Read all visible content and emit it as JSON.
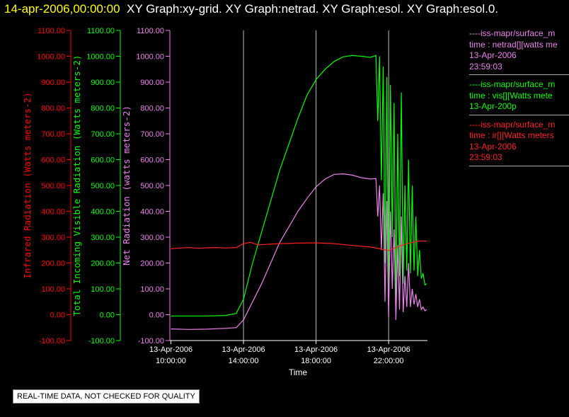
{
  "header": {
    "timestamp": "14-apr-2006,00:00:00",
    "graphs": "XY Graph:xy-grid.  XY Graph:netrad.  XY Graph:esol.  XY Graph:esol.0."
  },
  "status_note": "REAL-TIME DATA, NOT CHECKED FOR QUALITY",
  "legend": [
    {
      "color": "#ee82ee",
      "lines": [
        "----iss-mapr/surface_m",
        "time : netrad[][watts me",
        "13-Apr-2006",
        "23:59:03"
      ]
    },
    {
      "color": "#00ff00",
      "lines": [
        "----iss-mapr/surface_m",
        "time : vis[][Watts mete",
        "13-Apr-200p"
      ]
    },
    {
      "color": "#ff2020",
      "lines": [
        "----iss-mapr/surface_m",
        "time : ir[][Watts meters",
        "13-Apr-2006",
        "23:59:03"
      ]
    }
  ],
  "chart_data": {
    "type": "line",
    "xlabel": "Time",
    "x_ticks": [
      {
        "date": "13-Apr-2006",
        "time": "10:00:00",
        "hour": 10
      },
      {
        "date": "13-Apr-2006",
        "time": "14:00:00",
        "hour": 14
      },
      {
        "date": "13-Apr-2006",
        "time": "18:00:00",
        "hour": 18
      },
      {
        "date": "13-Apr-2006",
        "time": "22:00:00",
        "hour": 22
      }
    ],
    "xlim": [
      9.94,
      24.14
    ],
    "ylim": [
      -100,
      1100
    ],
    "y_ticks": [
      "-100.00",
      "0.00",
      "100.00",
      "200.00",
      "300.00",
      "400.00",
      "500.00",
      "600.00",
      "700.00",
      "800.00",
      "900.00",
      "1000.00",
      "1100.00"
    ],
    "vertical_grid_hours": [
      14,
      18,
      22
    ],
    "axes": [
      {
        "label": "Infrared Radiation (Watts meters-2)",
        "color": "#ff0000"
      },
      {
        "label": "Total Incoming Visible Radiation (Watts meters-2)",
        "color": "#00ff00"
      },
      {
        "label": "Net Radiation (watts meters-2)",
        "color": "#ee82ee"
      }
    ],
    "series": [
      {
        "color": "#00ff00",
        "points": [
          [
            10.0,
            -5
          ],
          [
            11,
            -5
          ],
          [
            12,
            -5
          ],
          [
            13,
            -3
          ],
          [
            13.6,
            5
          ],
          [
            14.0,
            60
          ],
          [
            14.5,
            200
          ],
          [
            15,
            320
          ],
          [
            15.5,
            440
          ],
          [
            16,
            560
          ],
          [
            16.5,
            660
          ],
          [
            17,
            760
          ],
          [
            17.5,
            850
          ],
          [
            18,
            910
          ],
          [
            18.5,
            950
          ],
          [
            19,
            980
          ],
          [
            19.5,
            998
          ],
          [
            20,
            1003
          ],
          [
            20.5,
            1000
          ],
          [
            21,
            996
          ],
          [
            21.3,
            1003
          ],
          [
            21.4,
            750
          ],
          [
            21.5,
            1000
          ],
          [
            21.6,
            520
          ],
          [
            21.7,
            960
          ],
          [
            21.8,
            200
          ],
          [
            21.9,
            920
          ],
          [
            22.0,
            80
          ],
          [
            22.1,
            890
          ],
          [
            22.2,
            300
          ],
          [
            22.3,
            820
          ],
          [
            22.4,
            60
          ],
          [
            22.5,
            700
          ],
          [
            22.6,
            150
          ],
          [
            22.7,
            860
          ],
          [
            22.8,
            120
          ],
          [
            22.9,
            500
          ],
          [
            23.0,
            170
          ],
          [
            23.1,
            600
          ],
          [
            23.2,
            160
          ],
          [
            23.3,
            500
          ],
          [
            23.4,
            170
          ],
          [
            23.5,
            380
          ],
          [
            23.6,
            150
          ],
          [
            23.7,
            250
          ],
          [
            23.8,
            140
          ],
          [
            23.9,
            160
          ],
          [
            24.0,
            115
          ],
          [
            24.1,
            120
          ]
        ]
      },
      {
        "color": "#ee82ee",
        "points": [
          [
            10.0,
            -55
          ],
          [
            11,
            -57
          ],
          [
            12,
            -56
          ],
          [
            13,
            -53
          ],
          [
            13.6,
            -50
          ],
          [
            14.0,
            -20
          ],
          [
            14.5,
            50
          ],
          [
            15,
            120
          ],
          [
            15.5,
            200
          ],
          [
            16,
            280
          ],
          [
            16.5,
            340
          ],
          [
            17,
            400
          ],
          [
            17.5,
            450
          ],
          [
            18,
            495
          ],
          [
            18.5,
            525
          ],
          [
            19,
            543
          ],
          [
            19.5,
            545
          ],
          [
            20,
            540
          ],
          [
            20.5,
            530
          ],
          [
            21,
            525
          ],
          [
            21.3,
            527
          ],
          [
            21.4,
            380
          ],
          [
            21.5,
            500
          ],
          [
            21.6,
            250
          ],
          [
            21.7,
            470
          ],
          [
            21.8,
            50
          ],
          [
            21.9,
            440
          ],
          [
            22.0,
            -10
          ],
          [
            22.1,
            400
          ],
          [
            22.2,
            100
          ],
          [
            22.3,
            330
          ],
          [
            22.4,
            -20
          ],
          [
            22.5,
            270
          ],
          [
            22.6,
            20
          ],
          [
            22.7,
            380
          ],
          [
            22.8,
            10
          ],
          [
            22.9,
            150
          ],
          [
            23.0,
            30
          ],
          [
            23.1,
            200
          ],
          [
            23.2,
            30
          ],
          [
            23.3,
            100
          ],
          [
            23.4,
            40
          ],
          [
            23.5,
            80
          ],
          [
            23.6,
            30
          ],
          [
            23.7,
            60
          ],
          [
            23.8,
            20
          ],
          [
            23.9,
            30
          ],
          [
            24.0,
            15
          ],
          [
            24.1,
            20
          ]
        ]
      },
      {
        "color": "#ff2020",
        "points": [
          [
            10.0,
            255
          ],
          [
            10.5,
            258
          ],
          [
            11,
            260
          ],
          [
            11.5,
            257
          ],
          [
            12,
            259
          ],
          [
            12.5,
            260
          ],
          [
            13,
            258
          ],
          [
            13.6,
            260
          ],
          [
            14.0,
            275
          ],
          [
            14.4,
            280
          ],
          [
            14.8,
            270
          ],
          [
            15.2,
            272
          ],
          [
            16,
            275
          ],
          [
            17,
            277
          ],
          [
            18,
            278
          ],
          [
            19,
            275
          ],
          [
            20,
            268
          ],
          [
            20.5,
            265
          ],
          [
            21,
            262
          ],
          [
            21.5,
            255
          ],
          [
            22.0,
            248
          ],
          [
            22.4,
            260
          ],
          [
            22.8,
            270
          ],
          [
            23.2,
            278
          ],
          [
            23.6,
            285
          ],
          [
            24.1,
            285
          ]
        ]
      }
    ]
  }
}
